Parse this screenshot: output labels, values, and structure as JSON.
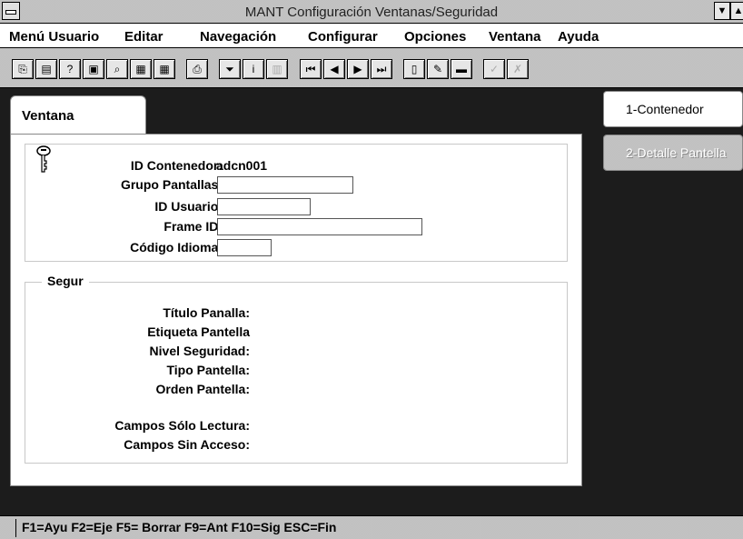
{
  "window": {
    "title": "MANT Configuración Ventanas/Seguridad"
  },
  "menubar": {
    "items": [
      "Menú Usuario",
      "Editar",
      "Navegación",
      "Configurar",
      "Opciones",
      "Ventana",
      "Ayuda"
    ]
  },
  "tabs": {
    "left": "Ventana",
    "right": [
      "1-Contenedor",
      "2-Detalle Pantella"
    ]
  },
  "form": {
    "id_contenedor_label": "ID Contenedor:",
    "id_contenedor_value": "adcn001",
    "grupo_label": "Grupo Pantallas:",
    "grupo_value": "",
    "usuario_label": "ID Usuario:",
    "usuario_value": "",
    "frame_label": "Frame ID:",
    "frame_value": "",
    "idioma_label": "Código Idioma:",
    "idioma_value": ""
  },
  "segur": {
    "title": "Segur",
    "labels": [
      "Título Panalla:",
      "Etiqueta Pantella",
      "Nivel Seguridad:",
      "Tipo Pantella:",
      "Orden Pantella:",
      "Campos Sólo Lectura:",
      "Campos Sin Acceso:"
    ]
  },
  "statusbar": {
    "text": "F1=Ayu  F2=Eje  F5= Borrar  F9=Ant  F10=Sig  ESC=Fin"
  },
  "toolbar": {
    "icons": [
      "copy-icon",
      "paste-icon",
      "help-icon",
      "clipboard-icon",
      "search-icon",
      "grid-dark-icon",
      "table-icon",
      "print-icon",
      "filter-icon",
      "info-icon",
      "chart-icon",
      "first-record-icon",
      "prev-record-icon",
      "next-record-icon",
      "last-record-icon",
      "new-icon",
      "edit-icon",
      "delete-icon",
      "accept-icon",
      "cancel-icon"
    ]
  },
  "colors": {
    "desktop": "#3a3a3a",
    "dither": "#d6d6d6"
  }
}
